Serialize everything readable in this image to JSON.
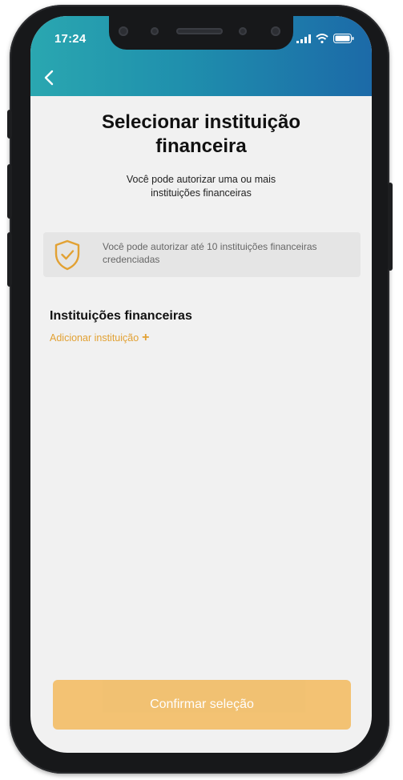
{
  "status_bar": {
    "time": "17:24"
  },
  "header": {
    "back_icon": "chevron-left-icon"
  },
  "main": {
    "title": "Selecionar instituição\nfinanceira",
    "subtitle": "Você pode autorizar uma ou mais\ninstituições financeiras",
    "info_card": {
      "icon": "shield-check-icon",
      "text": "Você pode autorizar até 10 instituições financeiras credenciadas"
    },
    "section_title": "Instituições financeiras",
    "add_link": {
      "label": "Adicionar instituição",
      "icon": "plus-icon"
    }
  },
  "footer": {
    "confirm_label": "Confirmar seleção"
  },
  "colors": {
    "accent_orange": "#e2a133",
    "button_orange": "#f2bf6c",
    "header_teal": "#2aa7b0",
    "header_blue": "#1c6aa8"
  }
}
